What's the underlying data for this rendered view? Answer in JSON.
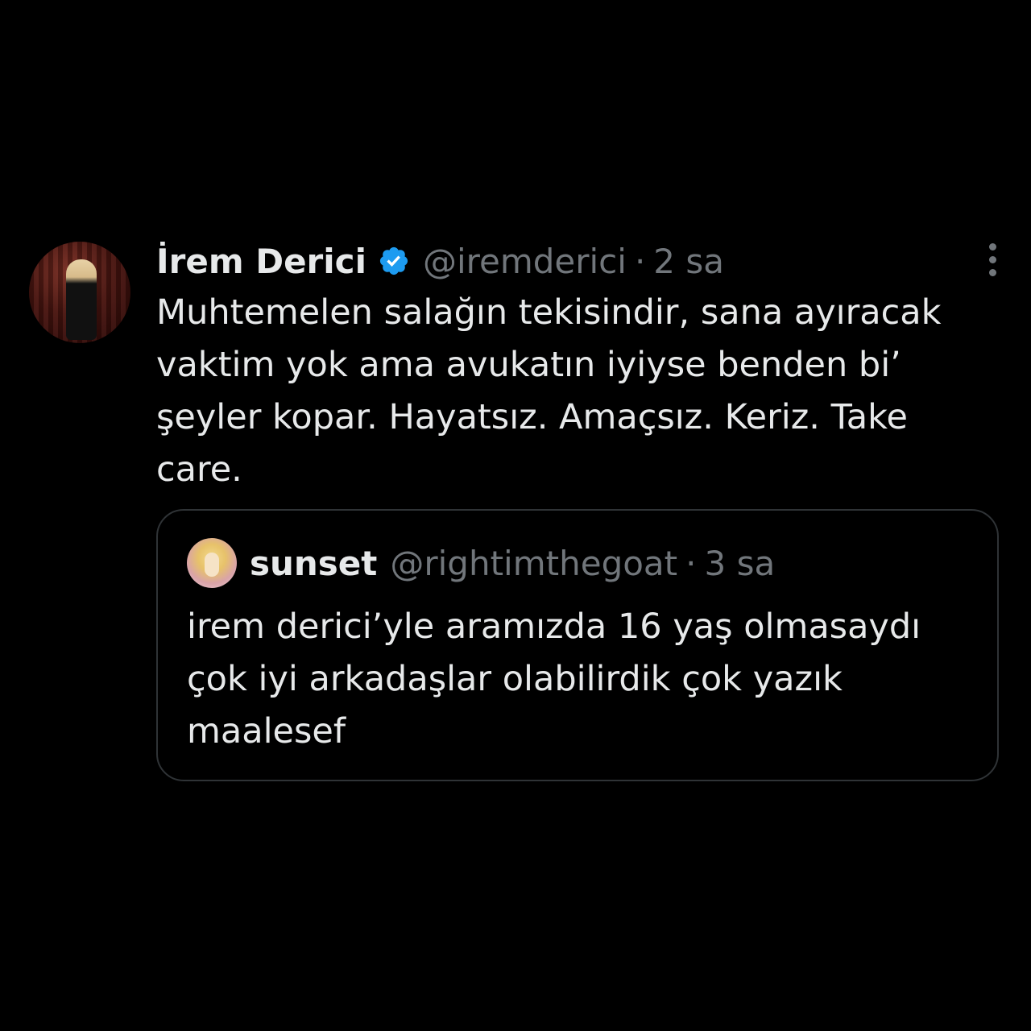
{
  "tweet": {
    "display_name": "İrem Derici",
    "handle": "@iremderici",
    "separator": "·",
    "time": "2 sa",
    "text": "Muhtemelen salağın tekisindir, sana ayıracak vaktim yok ama avukatın iyiyse benden bi’ şeyler kopar. Hayatsız. Amaçsız. Keriz. Take care.",
    "avatar_icon": "profile-photo",
    "verified_icon": "verified-badge-icon",
    "more_icon": "vertical-ellipsis-icon"
  },
  "quoted_tweet": {
    "display_name": "sunset",
    "handle": "@rightimthegoat",
    "separator": "·",
    "time": "3 sa",
    "text": "irem derici’yle aramızda 16 yaş olmasaydı çok iyi arkadaşlar olabilirdik çok yazık maalesef",
    "avatar_icon": "profile-photo"
  },
  "colors": {
    "background": "#000000",
    "primary_text": "#e7e9ea",
    "secondary_text": "#71767b",
    "verified_blue": "#1d9bf0",
    "border": "#2f3336"
  }
}
